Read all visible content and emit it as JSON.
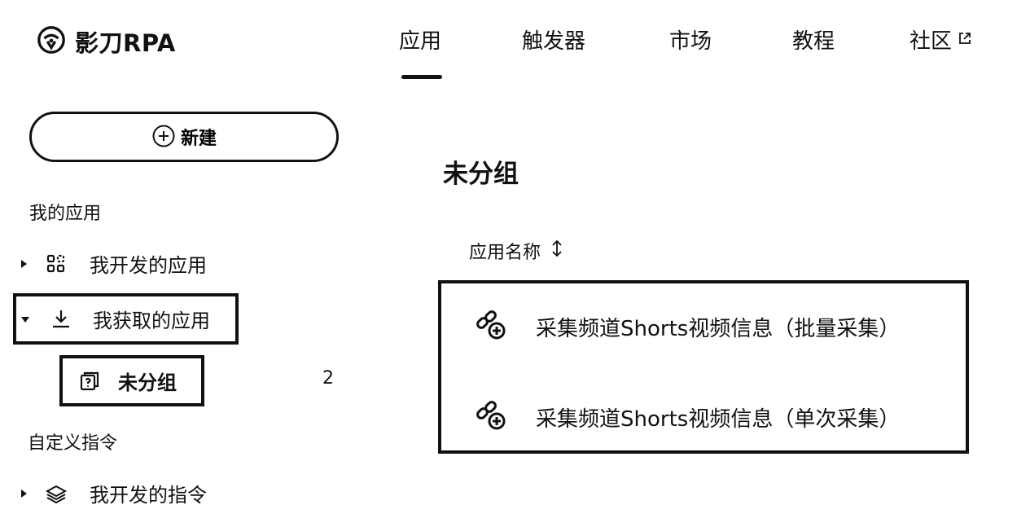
{
  "header": {
    "logo_text": "影刀RPA",
    "nav": [
      {
        "label": "应用",
        "active": true
      },
      {
        "label": "触发器"
      },
      {
        "label": "市场"
      },
      {
        "label": "教程"
      },
      {
        "label": "社区",
        "external": true
      }
    ]
  },
  "sidebar": {
    "new_button_label": "新建",
    "sections": [
      {
        "label": "我的应用"
      },
      {
        "label": "自定义指令"
      }
    ],
    "items": [
      {
        "label": "我开发的应用",
        "icon": "apps-grid-icon",
        "expanded": false
      },
      {
        "label": "我获取的应用",
        "icon": "download-icon",
        "expanded": true
      },
      {
        "label": "未分组",
        "icon": "folder-question-icon",
        "count": "2"
      },
      {
        "label": "我开发的指令",
        "icon": "layers-icon",
        "expanded": false
      }
    ]
  },
  "main": {
    "title": "未分组",
    "column_header": "应用名称",
    "apps": [
      {
        "name": "采集频道Shorts视频信息（批量采集）",
        "icon": "link-plus-icon"
      },
      {
        "name": "采集频道Shorts视频信息（单次采集）",
        "icon": "link-plus-icon"
      }
    ]
  },
  "colors": {
    "text": "#111111",
    "background": "#ffffff"
  }
}
